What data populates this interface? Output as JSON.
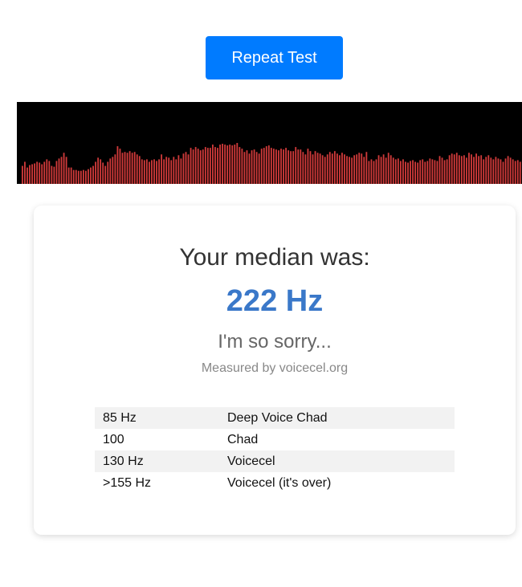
{
  "repeat_button": {
    "label": "Repeat Test"
  },
  "visualizer": {
    "bar_color": "#d03a3a",
    "background": "#000000",
    "levels": [
      0.22,
      0.27,
      0.2,
      0.23,
      0.24,
      0.25,
      0.27,
      0.26,
      0.24,
      0.27,
      0.3,
      0.28,
      0.22,
      0.21,
      0.28,
      0.31,
      0.33,
      0.38,
      0.33,
      0.2,
      0.2,
      0.17,
      0.17,
      0.16,
      0.16,
      0.17,
      0.16,
      0.18,
      0.2,
      0.22,
      0.27,
      0.32,
      0.3,
      0.26,
      0.22,
      0.27,
      0.31,
      0.33,
      0.36,
      0.46,
      0.43,
      0.38,
      0.39,
      0.38,
      0.4,
      0.38,
      0.39,
      0.36,
      0.34,
      0.3,
      0.29,
      0.3,
      0.27,
      0.29,
      0.3,
      0.28,
      0.3,
      0.36,
      0.3,
      0.33,
      0.32,
      0.29,
      0.33,
      0.3,
      0.35,
      0.31,
      0.37,
      0.39,
      0.36,
      0.44,
      0.42,
      0.45,
      0.43,
      0.41,
      0.42,
      0.45,
      0.44,
      0.44,
      0.48,
      0.45,
      0.44,
      0.48,
      0.49,
      0.48,
      0.47,
      0.48,
      0.47,
      0.48,
      0.5,
      0.45,
      0.43,
      0.39,
      0.41,
      0.37,
      0.41,
      0.42,
      0.39,
      0.37,
      0.43,
      0.44,
      0.46,
      0.47,
      0.44,
      0.43,
      0.42,
      0.41,
      0.43,
      0.42,
      0.44,
      0.41,
      0.4,
      0.4,
      0.45,
      0.42,
      0.42,
      0.39,
      0.36,
      0.43,
      0.4,
      0.36,
      0.4,
      0.38,
      0.37,
      0.35,
      0.33,
      0.36,
      0.39,
      0.37,
      0.4,
      0.37,
      0.35,
      0.38,
      0.36,
      0.34,
      0.33,
      0.32,
      0.35,
      0.36,
      0.38,
      0.37,
      0.33,
      0.39,
      0.28,
      0.3,
      0.28,
      0.3,
      0.35,
      0.33,
      0.36,
      0.32,
      0.38,
      0.35,
      0.32,
      0.3,
      0.31,
      0.28,
      0.3,
      0.27,
      0.26,
      0.28,
      0.29,
      0.27,
      0.26,
      0.29,
      0.3,
      0.27,
      0.28,
      0.31,
      0.3,
      0.29,
      0.28,
      0.34,
      0.32,
      0.29,
      0.3,
      0.35,
      0.37,
      0.36,
      0.38,
      0.35,
      0.34,
      0.35,
      0.32,
      0.38,
      0.36,
      0.33,
      0.37,
      0.34,
      0.35,
      0.3,
      0.33,
      0.35,
      0.32,
      0.3,
      0.33,
      0.31,
      0.3,
      0.27,
      0.31,
      0.34,
      0.32,
      0.3,
      0.28,
      0.29,
      0.27,
      0.29,
      0.3
    ]
  },
  "result": {
    "heading": "Your median was:",
    "value": "222 Hz",
    "value_color": "#3a78c9",
    "verdict": "I'm so sorry...",
    "measured_by": "Measured by voicecel.org"
  },
  "reference_table": {
    "rows": [
      {
        "hz": "85 Hz",
        "label": "Deep Voice Chad"
      },
      {
        "hz": "100",
        "label": "Chad"
      },
      {
        "hz": "130 Hz",
        "label": "Voicecel"
      },
      {
        "hz": ">155 Hz",
        "label": "Voicecel (it's over)"
      }
    ]
  },
  "colors": {
    "button_bg": "#007bff",
    "button_text": "#ffffff",
    "row_shade": "#f2f2f2"
  }
}
